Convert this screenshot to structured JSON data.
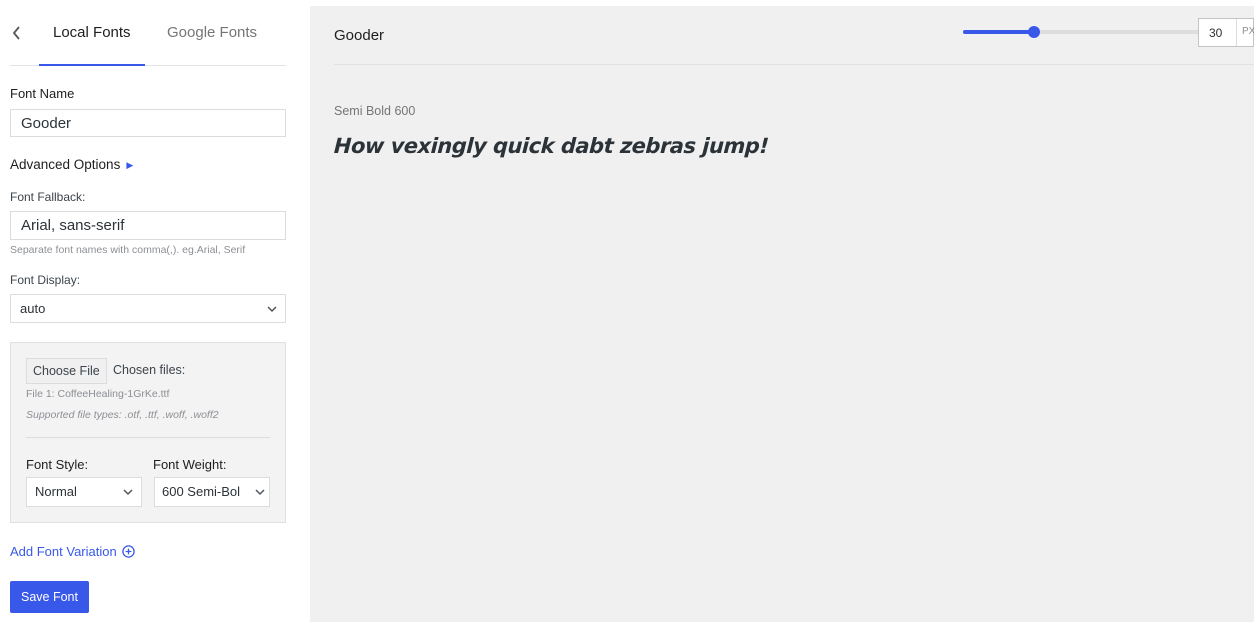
{
  "sidebar": {
    "back_icon": "chevron-left-icon",
    "tabs": [
      {
        "label": "Local Fonts",
        "active": true
      },
      {
        "label": "Google Fonts",
        "active": false
      }
    ],
    "font_name": {
      "label": "Font Name",
      "value": "Gooder"
    },
    "advanced_options": {
      "label": "Advanced Options",
      "icon": "triangle-right-icon"
    },
    "font_fallback": {
      "label": "Font Fallback:",
      "value": "Arial, sans-serif",
      "help": "Separate font names with comma(,). eg.Arial, Serif"
    },
    "font_display": {
      "label": "Font Display:",
      "value": "auto"
    },
    "file_upload": {
      "button_label": "Choose File",
      "chosen_label": "Chosen files:",
      "file_name": "File 1: CoffeeHealing-1GrKe.ttf",
      "supported_types": "Supported file types: .otf, .ttf, .woff, .woff2"
    },
    "font_style": {
      "label": "Font Style:",
      "value": "Normal"
    },
    "font_weight": {
      "label": "Font Weight:",
      "value": "600 Semi-Bol"
    },
    "add_variation": {
      "label": "Add Font Variation",
      "icon": "plus-circle-icon"
    },
    "save_label": "Save Font"
  },
  "preview": {
    "title": "Gooder",
    "size_slider": {
      "value": 30,
      "fraction": 0.29
    },
    "size_value": "30",
    "size_unit": "PX",
    "weight_label": "Semi Bold 600",
    "sample_text": "How vexingly quick dabt zebras jump!"
  },
  "colors": {
    "accent": "#3858e9",
    "preview_bg": "#f0f0f1",
    "panel_bg": "#f3f3f3"
  }
}
